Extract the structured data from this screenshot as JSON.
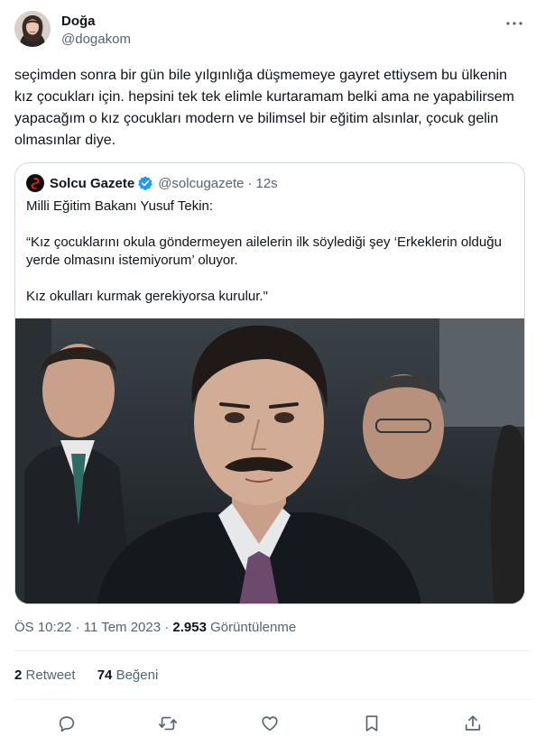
{
  "author": {
    "display_name": "Doğa",
    "handle": "@dogakom",
    "avatar_icon": "profile-photo"
  },
  "tweet": {
    "text": "seçimden sonra bir gün bile yılgınlığa düşmemeye gayret ettiysem bu ülkenin kız çocukları için. hepsini tek tek elimle kurtaramam belki ama ne yapabilirsem yapacağım o kız çocukları modern ve bilimsel bir eğitim alsınlar, çocuk gelin olmasınlar diye."
  },
  "quote": {
    "name": "Solcu Gazete",
    "handle": "@solcugazete",
    "separator": "·",
    "time": "12s",
    "line1": "Milli Eğitim Bakanı Yusuf Tekin:",
    "line2": "“Kız çocuklarını okula göndermeyen ailelerin ilk söylediği şey ‘Erkeklerin olduğu yerde olmasını istemiyorum’ oluyor.",
    "line3": "Kız okulları kurmak gerekiyorsa kurulur.\"",
    "logo_icon": "solcu-gazete-logo",
    "verified_icon": "verified-badge-icon"
  },
  "meta": {
    "time": "ÖS 10:22",
    "separator": "·",
    "date": "11 Tem 2023",
    "views_count": "2.953",
    "views_label": "Görüntülenme"
  },
  "stats": {
    "retweets_count": "2",
    "retweets_label": "Retweet",
    "likes_count": "74",
    "likes_label": "Beğeni"
  },
  "colors": {
    "text": "#0f1419",
    "secondary": "#536471",
    "border": "#cfd9de",
    "verified": "#1d9bf0"
  },
  "icons": [
    "more-icon",
    "reply-icon",
    "retweet-icon",
    "like-icon",
    "bookmark-icon",
    "share-icon"
  ]
}
